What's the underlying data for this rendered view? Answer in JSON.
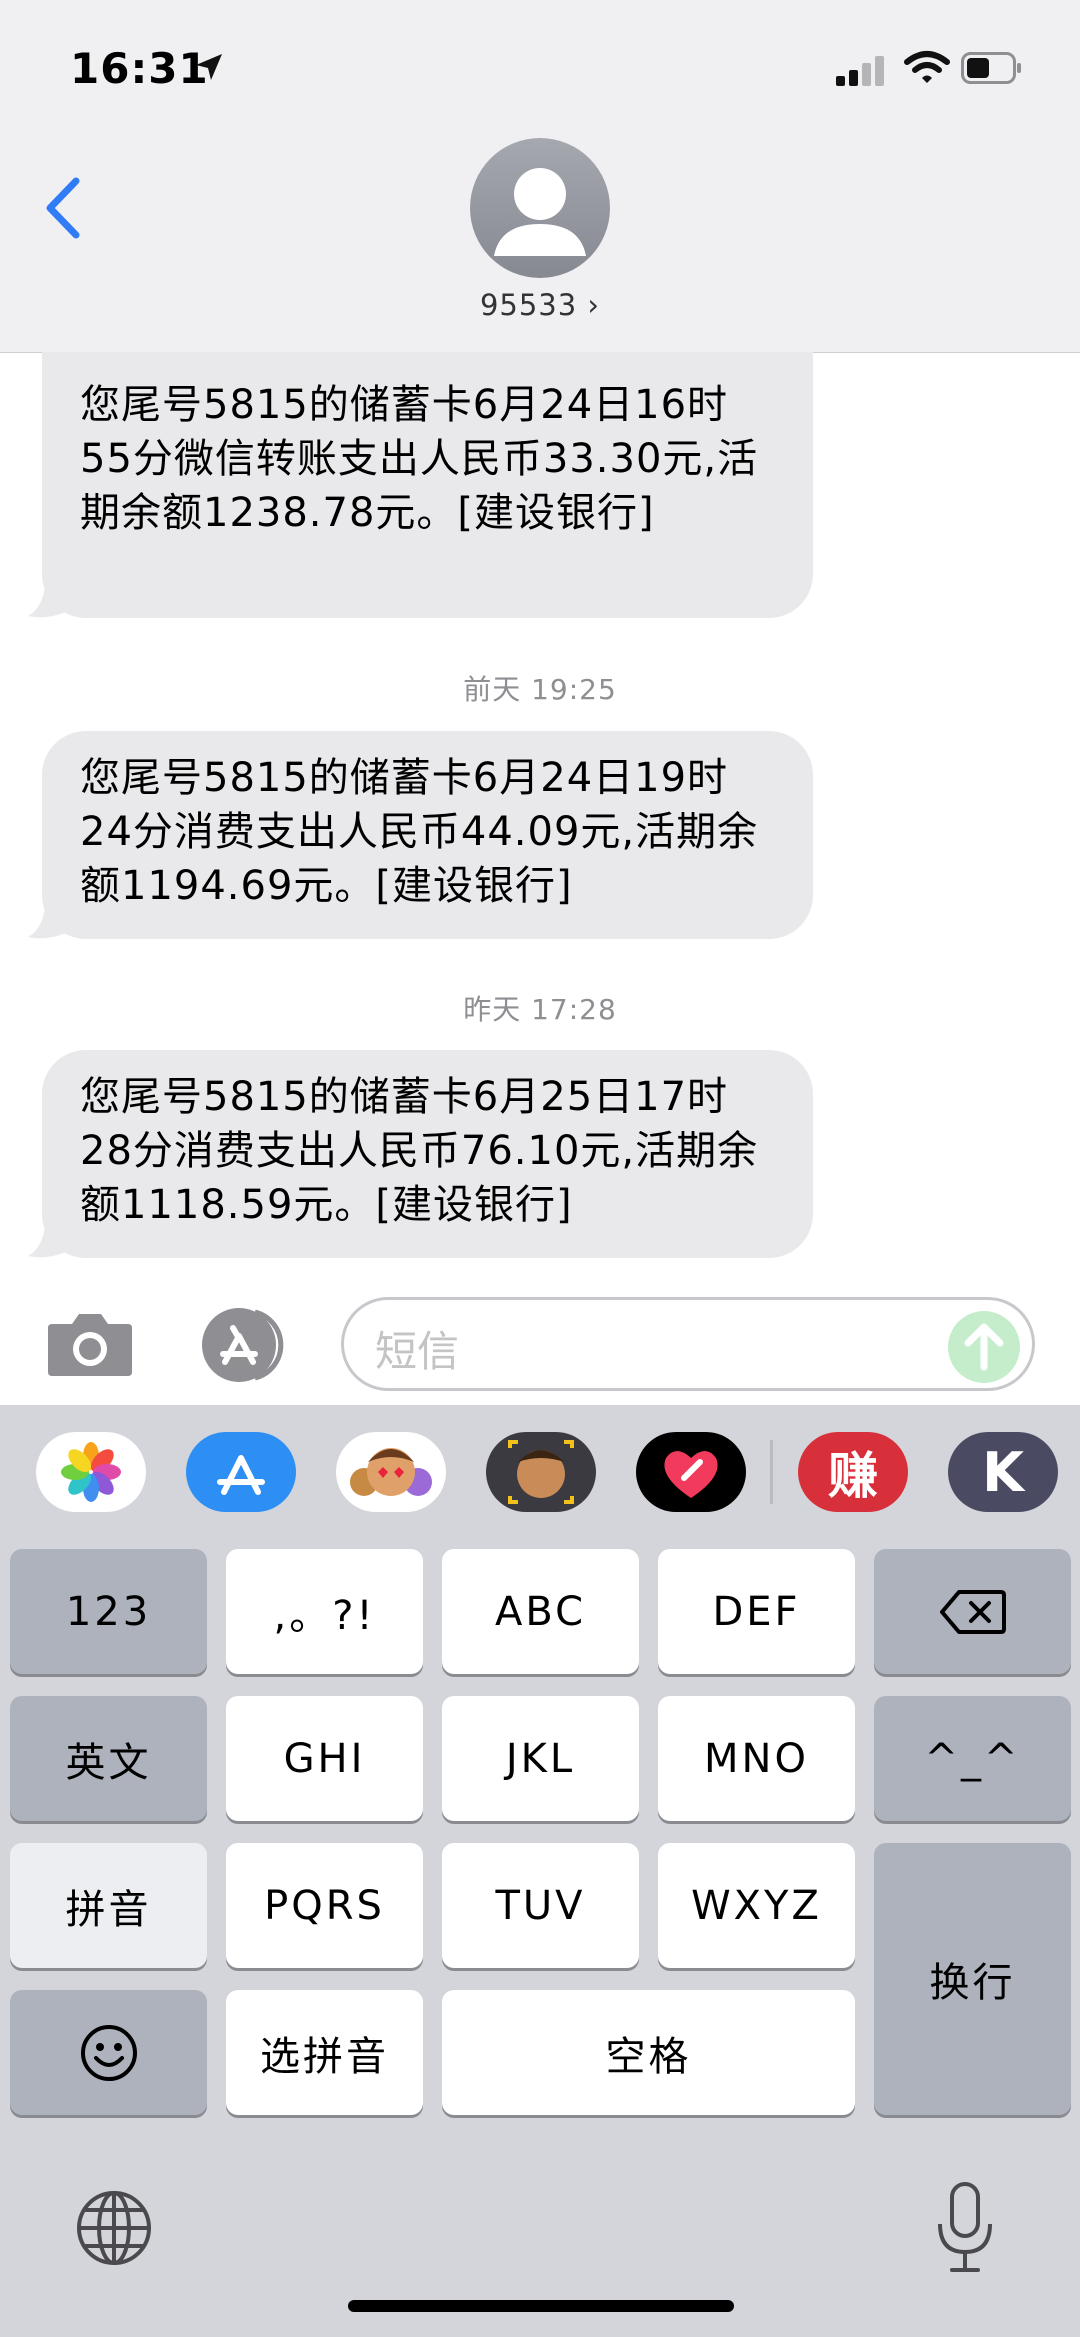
{
  "status_bar": {
    "time": "16:31"
  },
  "conversation": {
    "contact": "95533 ›"
  },
  "messages": [
    {
      "text": "您尾号5815的储蓄卡6月24日16时55分微信转账支出人民币33.30元,活期余额1238.78元。[建设银行]"
    },
    {
      "timestamp": "前天 19:25",
      "text": "您尾号5815的储蓄卡6月24日19时24分消费支出人民币44.09元,活期余额1194.69元。[建设银行]"
    },
    {
      "timestamp": "昨天 17:28",
      "text": "您尾号5815的储蓄卡6月25日17时28分消费支出人民币76.10元,活期余额1118.59元。[建设银行]"
    }
  ],
  "composer": {
    "placeholder": "短信"
  },
  "app_strip": [
    {
      "name": "photos-app-icon"
    },
    {
      "name": "app-store-icon"
    },
    {
      "name": "memoji-stickers-icon"
    },
    {
      "name": "memoji-camera-icon"
    },
    {
      "name": "digital-touch-icon"
    },
    {
      "name": "zhuan-app-icon",
      "label": "赚"
    },
    {
      "name": "k-app-icon",
      "label": "K"
    }
  ],
  "keyboard": {
    "row1": [
      "123",
      ",。?!",
      "ABC",
      "DEF"
    ],
    "row2": [
      "英文",
      "GHI",
      "JKL",
      "MNO",
      "^_^"
    ],
    "row3": [
      "拼音",
      "PQRS",
      "TUV",
      "WXYZ"
    ],
    "row4": [
      "选拼音",
      "空格"
    ],
    "return": "换行"
  },
  "colors": {
    "accent_blue": "#2f7cf6",
    "bubble_gray": "#e9e9eb",
    "send_green": "#c5edcb"
  }
}
